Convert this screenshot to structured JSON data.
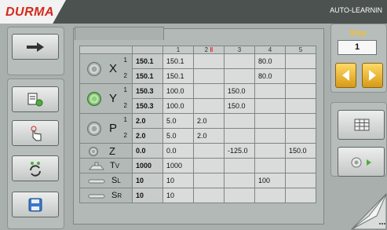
{
  "app": {
    "logo": "DURMA",
    "mode": "AUTO-LEARNIN"
  },
  "step": {
    "label": "Step",
    "value": "1"
  },
  "table": {
    "col_headers": [
      "1",
      "2",
      "3",
      "4",
      "5"
    ],
    "rows": [
      {
        "axis": "X",
        "sub": "1",
        "active": "150.1",
        "cells": [
          "150.1",
          "",
          "",
          "80.0",
          ""
        ]
      },
      {
        "axis": "",
        "sub": "2",
        "active": "150.1",
        "cells": [
          "150.1",
          "",
          "",
          "80.0",
          ""
        ]
      },
      {
        "axis": "Y",
        "sub": "1",
        "active": "150.3",
        "cells": [
          "100.0",
          "",
          "150.0",
          "",
          ""
        ]
      },
      {
        "axis": "",
        "sub": "2",
        "active": "150.3",
        "cells": [
          "100.0",
          "",
          "150.0",
          "",
          ""
        ]
      },
      {
        "axis": "P",
        "sub": "1",
        "active": "2.0",
        "cells": [
          "5.0",
          "2.0",
          "",
          "",
          ""
        ]
      },
      {
        "axis": "",
        "sub": "2",
        "active": "2.0",
        "cells": [
          "5.0",
          "2.0",
          "",
          "",
          ""
        ]
      },
      {
        "axis": "Z",
        "sub": "",
        "active": "0.0",
        "cells": [
          "0.0",
          "",
          "-125.0",
          "",
          "150.0"
        ]
      },
      {
        "axis": "TV",
        "sub": "",
        "active": "1000",
        "cells": [
          "1000",
          "",
          "",
          "",
          ""
        ]
      },
      {
        "axis": "SL",
        "sub": "",
        "active": "10",
        "cells": [
          "10",
          "",
          "",
          "100",
          ""
        ]
      },
      {
        "axis": "SR",
        "sub": "",
        "active": "10",
        "cells": [
          "10",
          "",
          "",
          "",
          ""
        ]
      }
    ]
  },
  "colors": {
    "accent": "#d6281c",
    "step_label": "#f0c030",
    "arrow": "#f2b630",
    "active_axis": "#6fc15c"
  },
  "icons": [
    "forward-arrow-icon",
    "program-icon",
    "touch-icon",
    "refresh-icon",
    "save-icon",
    "grid-icon",
    "axis-reset-icon",
    "page-next-icon"
  ]
}
